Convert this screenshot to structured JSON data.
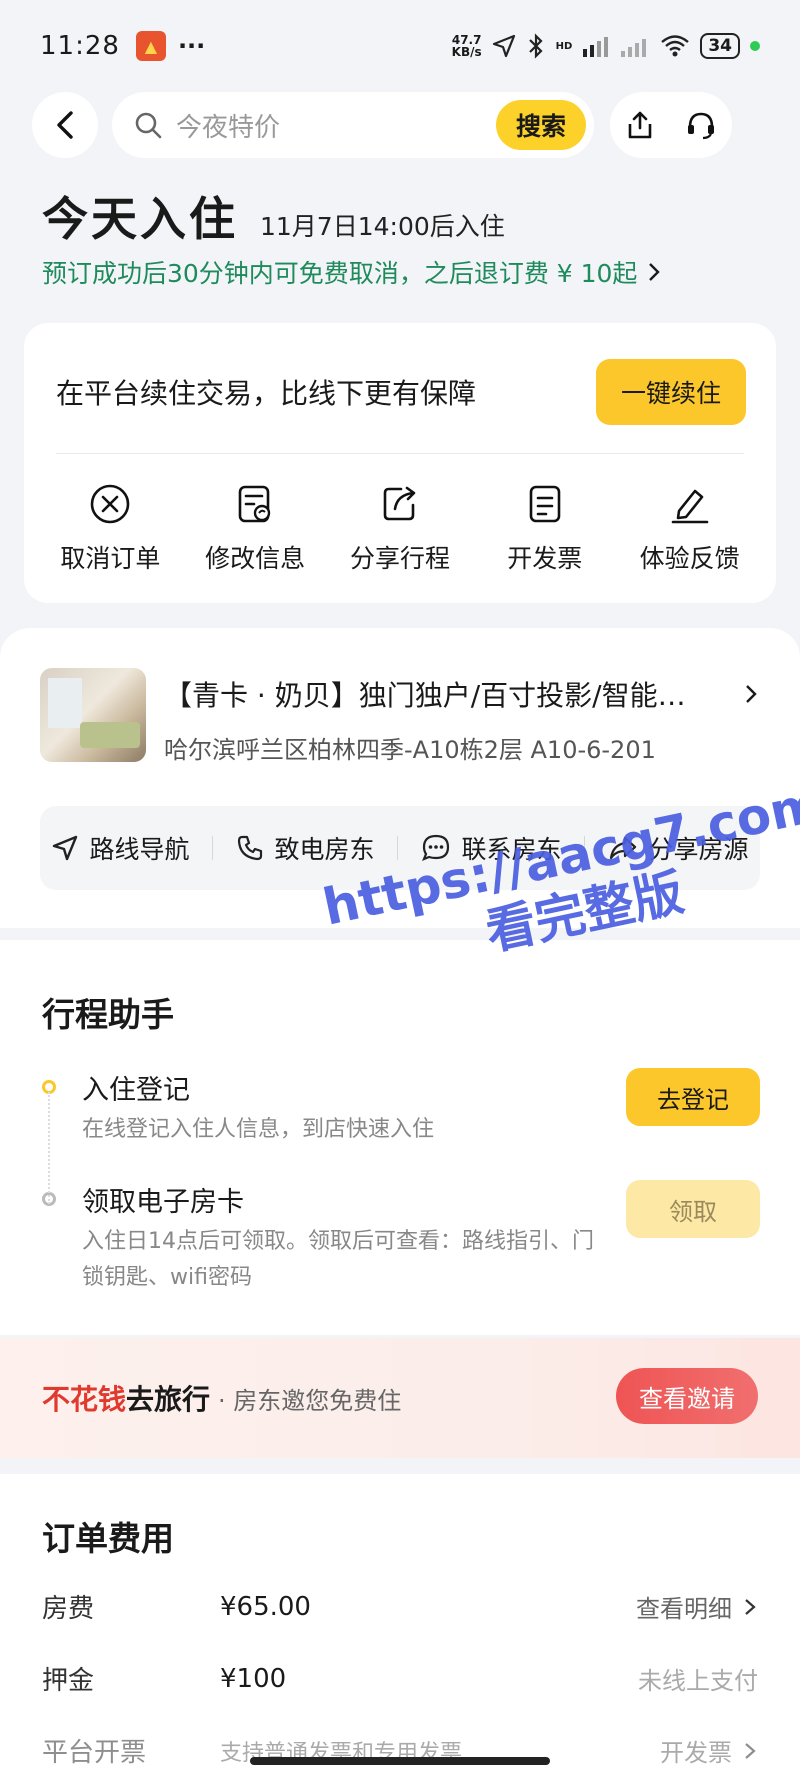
{
  "status_bar": {
    "time": "11:28",
    "more": "···",
    "net_speed_top": "47.7",
    "net_speed_bottom": "KB/s",
    "hd": "HD",
    "battery": "34"
  },
  "search": {
    "placeholder": "今夜特价",
    "button": "搜索"
  },
  "checkin": {
    "title": "今天入住",
    "time": "11月7日14:00后入住",
    "cancel_note": "预订成功后30分钟内可免费取消，之后退订费 ¥ 10起"
  },
  "renew": {
    "text": "在平台续住交易，比线下更有保障",
    "button": "一键续住"
  },
  "quick_actions": [
    {
      "label": "取消订单",
      "icon": "cancel-circle-icon"
    },
    {
      "label": "修改信息",
      "icon": "edit-info-icon"
    },
    {
      "label": "分享行程",
      "icon": "share-trip-icon"
    },
    {
      "label": "开发票",
      "icon": "invoice-icon"
    },
    {
      "label": "体验反馈",
      "icon": "feedback-pen-icon"
    }
  ],
  "listing": {
    "name": "【青卡 · 奶贝】独门独户/百寸投影/智能…",
    "address": "哈尔滨呼兰区柏林四季-A10栋2层 A10-6-201"
  },
  "contacts": [
    {
      "label": "路线导航",
      "icon": "navigation-icon"
    },
    {
      "label": "致电房东",
      "icon": "phone-icon"
    },
    {
      "label": "联系房东",
      "icon": "chat-icon"
    },
    {
      "label": "分享房源",
      "icon": "share-arrow-icon"
    }
  ],
  "assistant": {
    "title": "行程助手",
    "steps": [
      {
        "title": "入住登记",
        "desc": "在线登记入住人信息，到店快速入住",
        "button": "去登记"
      },
      {
        "title": "领取电子房卡",
        "desc": "入住日14点后可领取。领取后可查看：路线指引、门锁钥匙、wifi密码",
        "button": "领取"
      }
    ]
  },
  "promo": {
    "red": "不花钱",
    "black": "去旅行",
    "sub": "· 房东邀您免费住",
    "button": "查看邀请"
  },
  "fees": {
    "title": "订单费用",
    "rows": [
      {
        "key": "房费",
        "value": "¥65.00",
        "right": "查看明细"
      },
      {
        "key": "押金",
        "value": "¥100",
        "right": "未线上支付"
      },
      {
        "key": "平台开票",
        "value": "支持普通发票和专用发票",
        "right": "开发票"
      }
    ]
  },
  "watermark": {
    "line1": "https://aacg7.com",
    "line2": "看完整版"
  },
  "colors": {
    "accent_yellow": "#fcc72a",
    "green_note": "#1f8a5c",
    "promo_red": "#e03a2e"
  }
}
